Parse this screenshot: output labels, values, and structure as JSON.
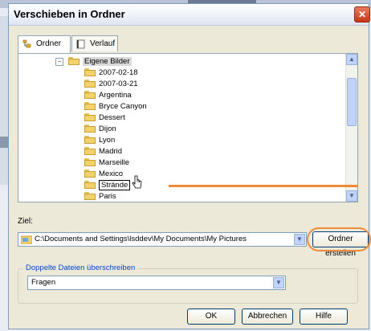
{
  "dialog": {
    "title": "Verschieben in Ordner",
    "close_glyph": "✕"
  },
  "tabs": [
    {
      "label": "Ordner",
      "active": true,
      "icon": "folder-tree-icon"
    },
    {
      "label": "Verlauf",
      "active": false,
      "icon": "history-icon"
    }
  ],
  "tree": {
    "root": {
      "label": "Eigene Bilder",
      "expander": "⊟"
    },
    "items": [
      "2007-02-18",
      "2007-03-21",
      "Argentina",
      "Bryce Canyon",
      "Dessert",
      "Dijon",
      "Lyon",
      "Madrid",
      "Marseille",
      "Mexico",
      "Strände",
      "Paris"
    ],
    "selected": "Strände"
  },
  "ziel": {
    "label": "Ziel:",
    "path": "C:\\Documents and Settings\\lsddev\\My Documents\\My Pictures",
    "new_folder_button": "Ordner erstellen"
  },
  "overwrite": {
    "group_label": "Doppelte Dateien überschreiben",
    "value": "Fragen"
  },
  "buttons": {
    "ok": "OK",
    "cancel": "Abbrechen",
    "help": "Hilfe"
  },
  "colors": {
    "accent": "#f08b3a",
    "border": "#7f9db9",
    "dialog_bg": "#ece9d8"
  }
}
